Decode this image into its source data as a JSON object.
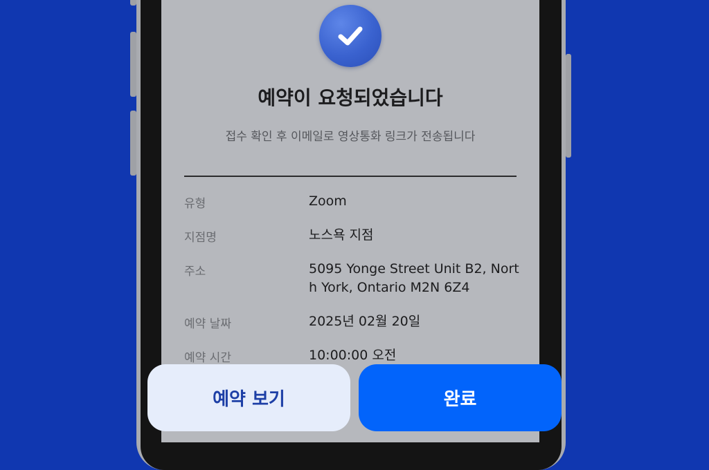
{
  "confirmation": {
    "title": "예약이 요청되었습니다",
    "subtitle": "접수 확인 후 이메일로 영상통화 링크가 전송됩니다"
  },
  "details": [
    {
      "label": "유형",
      "value": "Zoom"
    },
    {
      "label": "지점명",
      "value": "노스욕 지점"
    },
    {
      "label": "주소",
      "value": "5095 Yonge Street Unit B2, North York, Ontario M2N 6Z4"
    },
    {
      "label": "예약 날짜",
      "value": "2025년 02월 20일"
    },
    {
      "label": "예약 시간",
      "value": "10:00:00 오전"
    }
  ],
  "actions": {
    "view_label": "예약 보기",
    "done_label": "완료"
  },
  "colors": {
    "background": "#1037b0",
    "primary": "#0264fb",
    "secondary_bg": "#e6edfb",
    "check_circle": "#3a62cf"
  },
  "icons": {
    "status": "check-icon"
  }
}
